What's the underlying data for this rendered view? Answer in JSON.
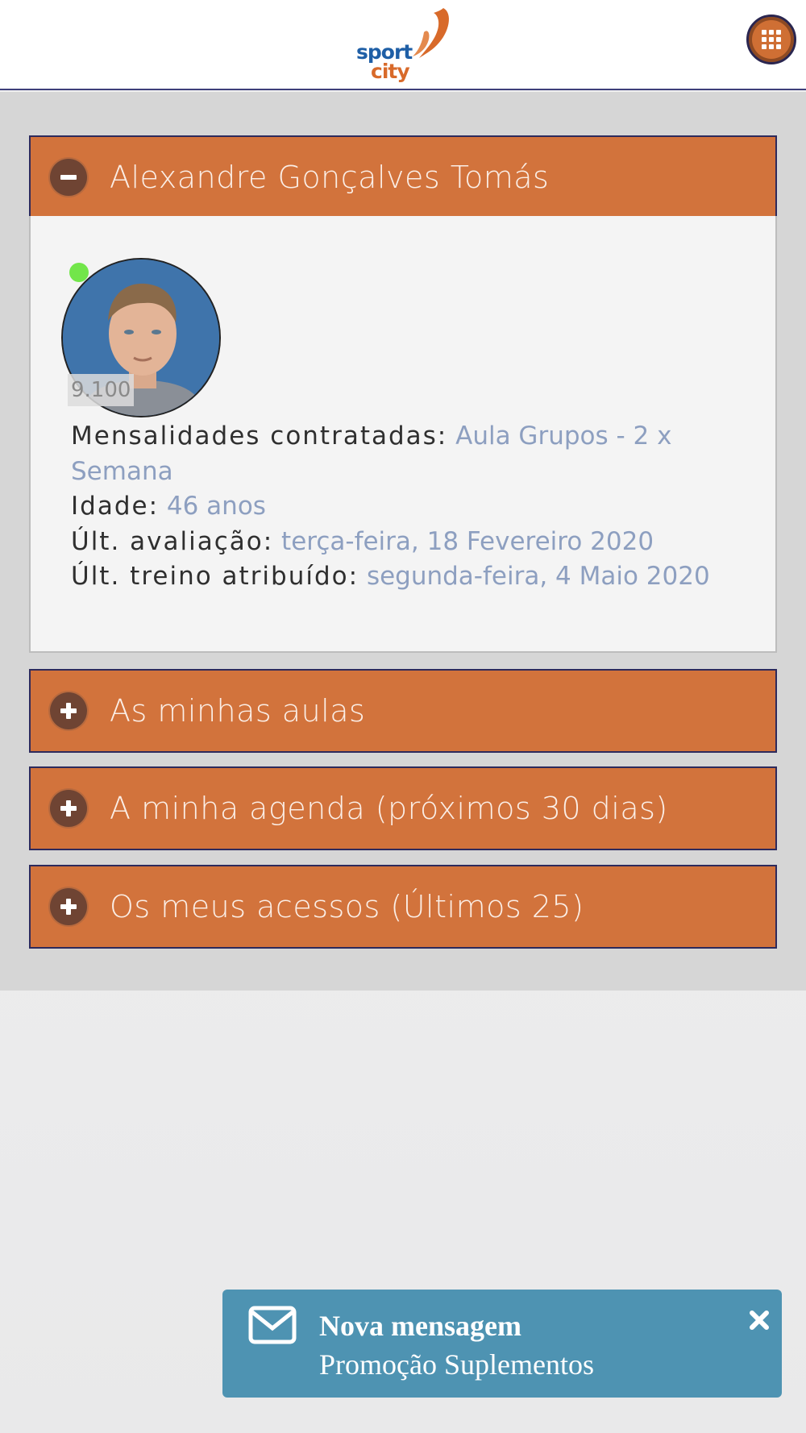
{
  "header": {
    "logo_top": "sport",
    "logo_bottom": "city"
  },
  "profile_section": {
    "title": "Alexandre Gonçalves Tomás",
    "member_number": "9.100",
    "status": "online",
    "details": [
      {
        "label": "Mensalidades contratadas:",
        "value": "Aula Grupos - 2 x Semana"
      },
      {
        "label": "Idade:",
        "value": "46 anos"
      },
      {
        "label": "Últ. avaliação:",
        "value": "terça-feira, 18 Fevereiro 2020"
      },
      {
        "label": "Últ. treino atribuído:",
        "value": "segunda-feira, 4 Maio 2020"
      }
    ]
  },
  "sections": [
    {
      "title": "As minhas aulas"
    },
    {
      "title": "A minha agenda (próximos 30 dias)"
    },
    {
      "title": "Os meus acessos (Últimos 25)"
    }
  ],
  "notification": {
    "title": "Nova mensagem",
    "message": "Promoção Suplementos"
  },
  "colors": {
    "accent": "#d2733c",
    "accent_border": "#2d2a5c",
    "value_text": "#8d9fc0",
    "toast": "#4e93b2",
    "online": "#72e64a"
  },
  "icons": {
    "apps": "grid-icon",
    "collapse": "minus-circle-icon",
    "expand": "plus-circle-icon",
    "mail": "envelope-icon",
    "close": "close-icon"
  }
}
